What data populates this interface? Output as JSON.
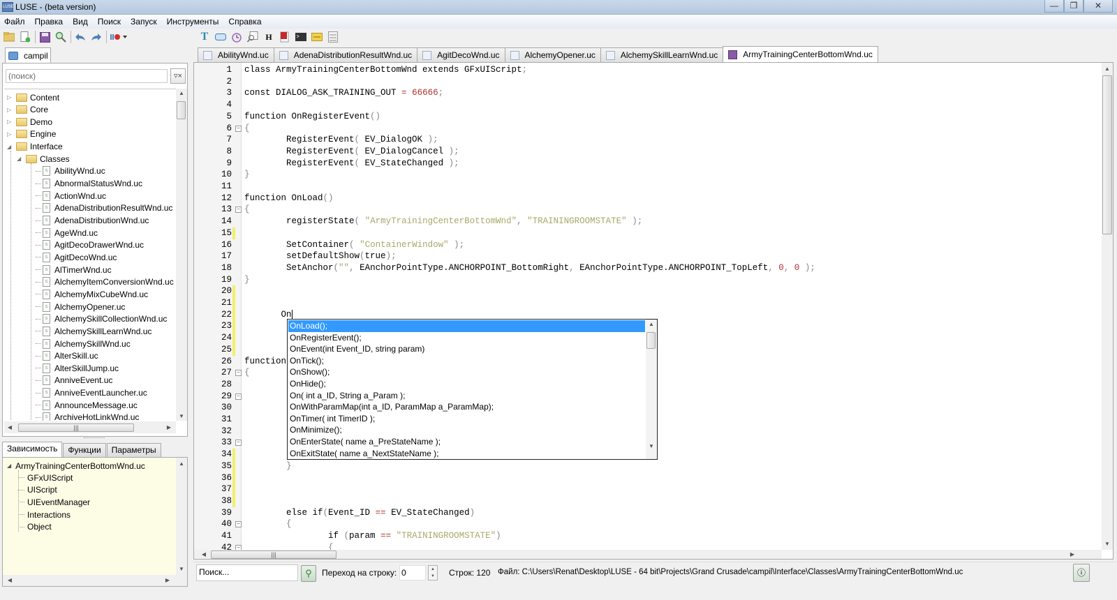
{
  "window": {
    "title": "LUSE - (beta version)",
    "app_icon": "LUSE",
    "controls": [
      "minimize-icon",
      "restore-icon",
      "close-icon"
    ]
  },
  "menu": [
    "Файл",
    "Правка",
    "Вид",
    "Поиск",
    "Запуск",
    "Инструменты",
    "Справка"
  ],
  "toolbar_left": [
    "open-folder-icon",
    "new-file-icon",
    "save-icon",
    "find-icon",
    "undo-icon",
    "redo-icon",
    "record-icon"
  ],
  "toolbar_right": [
    "text-icon",
    "button-icon",
    "timer-icon",
    "search-window-icon",
    "heading-icon",
    "flash-icon",
    "console-icon",
    "texture-icon",
    "list-icon"
  ],
  "project": {
    "tab_label": "campil",
    "search_placeholder": "(поиск)",
    "tree": [
      {
        "label": "Content",
        "type": "folder",
        "level": 0,
        "expanded": false
      },
      {
        "label": "Core",
        "type": "folder",
        "level": 0,
        "expanded": false
      },
      {
        "label": "Demo",
        "type": "folder",
        "level": 0,
        "expanded": false
      },
      {
        "label": "Engine",
        "type": "folder",
        "level": 0,
        "expanded": false
      },
      {
        "label": "Interface",
        "type": "folder",
        "level": 0,
        "expanded": true
      },
      {
        "label": "Classes",
        "type": "folder",
        "level": 1,
        "expanded": true
      },
      {
        "label": "AbilityWnd.uc",
        "type": "file",
        "level": 2
      },
      {
        "label": "AbnormalStatusWnd.uc",
        "type": "file",
        "level": 2
      },
      {
        "label": "ActionWnd.uc",
        "type": "file",
        "level": 2
      },
      {
        "label": "AdenaDistributionResultWnd.uc",
        "type": "file",
        "level": 2
      },
      {
        "label": "AdenaDistributionWnd.uc",
        "type": "file",
        "level": 2
      },
      {
        "label": "AgeWnd.uc",
        "type": "file",
        "level": 2
      },
      {
        "label": "AgitDecoDrawerWnd.uc",
        "type": "file",
        "level": 2
      },
      {
        "label": "AgitDecoWnd.uc",
        "type": "file",
        "level": 2
      },
      {
        "label": "AlTimerWnd.uc",
        "type": "file",
        "level": 2
      },
      {
        "label": "AlchemyItemConversionWnd.uc",
        "type": "file",
        "level": 2
      },
      {
        "label": "AlchemyMixCubeWnd.uc",
        "type": "file",
        "level": 2
      },
      {
        "label": "AlchemyOpener.uc",
        "type": "file",
        "level": 2
      },
      {
        "label": "AlchemySkillCollectionWnd.uc",
        "type": "file",
        "level": 2
      },
      {
        "label": "AlchemySkillLearnWnd.uc",
        "type": "file",
        "level": 2
      },
      {
        "label": "AlchemySkillWnd.uc",
        "type": "file",
        "level": 2
      },
      {
        "label": "AlterSkill.uc",
        "type": "file",
        "level": 2
      },
      {
        "label": "AlterSkillJump.uc",
        "type": "file",
        "level": 2
      },
      {
        "label": "AnniveEvent.uc",
        "type": "file",
        "level": 2
      },
      {
        "label": "AnniveEventLauncher.uc",
        "type": "file",
        "level": 2
      },
      {
        "label": "AnnounceMessage.uc",
        "type": "file",
        "level": 2
      },
      {
        "label": "ArchiveHotLinkWnd.uc",
        "type": "file",
        "level": 2
      }
    ]
  },
  "bottom_panel": {
    "tabs": [
      "Зависимость",
      "Функции",
      "Параметры"
    ],
    "active_tab": 0,
    "root": "ArmyTrainingCenterBottomWnd.uc",
    "children": [
      "GFxUIScript",
      "UIScript",
      "UIEventManager",
      "Interactions",
      "Object"
    ]
  },
  "editor": {
    "tabs": [
      "AbilityWnd.uc",
      "AdenaDistributionResultWnd.uc",
      "AgitDecoWnd.uc",
      "AlchemyOpener.uc",
      "AlchemySkillLearnWnd.uc",
      "ArmyTrainingCenterBottomWnd.uc"
    ],
    "active_tab": 5,
    "lines": [
      {
        "n": "1",
        "text": "class ArmyTrainingCenterBottomWnd extends GFxUIScript;"
      },
      {
        "n": "2",
        "text": ""
      },
      {
        "n": "3",
        "text": "const DIALOG_ASK_TRAINING_OUT = 66666;"
      },
      {
        "n": "4",
        "text": ""
      },
      {
        "n": "5",
        "text": "function OnRegisterEvent()"
      },
      {
        "n": "6",
        "text": "{",
        "fold": true
      },
      {
        "n": "7",
        "text": "        RegisterEvent( EV_DialogOK );"
      },
      {
        "n": "8",
        "text": "        RegisterEvent( EV_DialogCancel );"
      },
      {
        "n": "9",
        "text": "        RegisterEvent( EV_StateChanged );"
      },
      {
        "n": "10",
        "text": "}"
      },
      {
        "n": "11",
        "text": ""
      },
      {
        "n": "12",
        "text": "function OnLoad()"
      },
      {
        "n": "13",
        "text": "{",
        "fold": true
      },
      {
        "n": "14",
        "text": "        registerState( \"ArmyTrainingCenterBottomWnd\", \"TRAININGROOMSTATE\" );"
      },
      {
        "n": "15",
        "text": "",
        "modified": true
      },
      {
        "n": "16",
        "text": "        SetContainer( \"ContainerWindow\" );"
      },
      {
        "n": "17",
        "text": "        setDefaultShow(true);"
      },
      {
        "n": "18",
        "text": "        SetAnchor(\"\", EAnchorPointType.ANCHORPOINT_BottomRight, EAnchorPointType.ANCHORPOINT_TopLeft, 0, 0 );"
      },
      {
        "n": "19",
        "text": "}"
      },
      {
        "n": "20",
        "text": "",
        "modified": true
      },
      {
        "n": "21",
        "text": "",
        "modified": true
      },
      {
        "n": "22",
        "text": "       On",
        "modified": true
      },
      {
        "n": "23",
        "text": "",
        "modified": true
      },
      {
        "n": "24",
        "text": "",
        "modified": true
      },
      {
        "n": "25",
        "text": "",
        "modified": true
      },
      {
        "n": "26",
        "text": "function"
      },
      {
        "n": "27",
        "text": "{",
        "fold": true
      },
      {
        "n": "28",
        "text": ""
      },
      {
        "n": "29",
        "text": "",
        "fold": true
      },
      {
        "n": "30",
        "text": ""
      },
      {
        "n": "31",
        "text": ""
      },
      {
        "n": "32",
        "text": ""
      },
      {
        "n": "33",
        "text": "",
        "fold": true
      },
      {
        "n": "34",
        "text": "",
        "modified": true
      },
      {
        "n": "35",
        "text": "        }",
        "modified": true
      },
      {
        "n": "36",
        "text": "",
        "modified": true
      },
      {
        "n": "37",
        "text": "",
        "modified": true
      },
      {
        "n": "38",
        "text": "",
        "modified": true
      },
      {
        "n": "39",
        "text": "        else if(Event_ID == EV_StateChanged)"
      },
      {
        "n": "40",
        "text": "        {",
        "fold": true
      },
      {
        "n": "41",
        "text": "                if (param == \"TRAININGROOMSTATE\")"
      },
      {
        "n": "42",
        "text": "                {",
        "fold": true
      }
    ]
  },
  "autocomplete": {
    "selected": 0,
    "items": [
      "OnLoad();",
      "OnRegisterEvent();",
      "OnEvent(int Event_ID, string param)",
      "OnTick();",
      "OnShow();",
      "OnHide();",
      "On( int a_ID, String a_Param );",
      "OnWithParamMap(int a_ID, ParamMap a_ParamMap);",
      "OnTimer( int TimerID );",
      "OnMinimize();",
      "OnEnterState( name a_PreStateName );",
      "OnExitState( name a_NextStateName );"
    ]
  },
  "statusbar": {
    "search_placeholder": "Поиск...",
    "goto_label": "Переход на строку:",
    "goto_value": "0",
    "lines_label": "Строк: 120",
    "file_label": "Файл: C:\\Users\\Renat\\Desktop\\LUSE - 64 bit\\Projects\\Grand Crusade\\campil\\Interface\\Classes\\ArmyTrainingCenterBottomWnd.uc"
  }
}
